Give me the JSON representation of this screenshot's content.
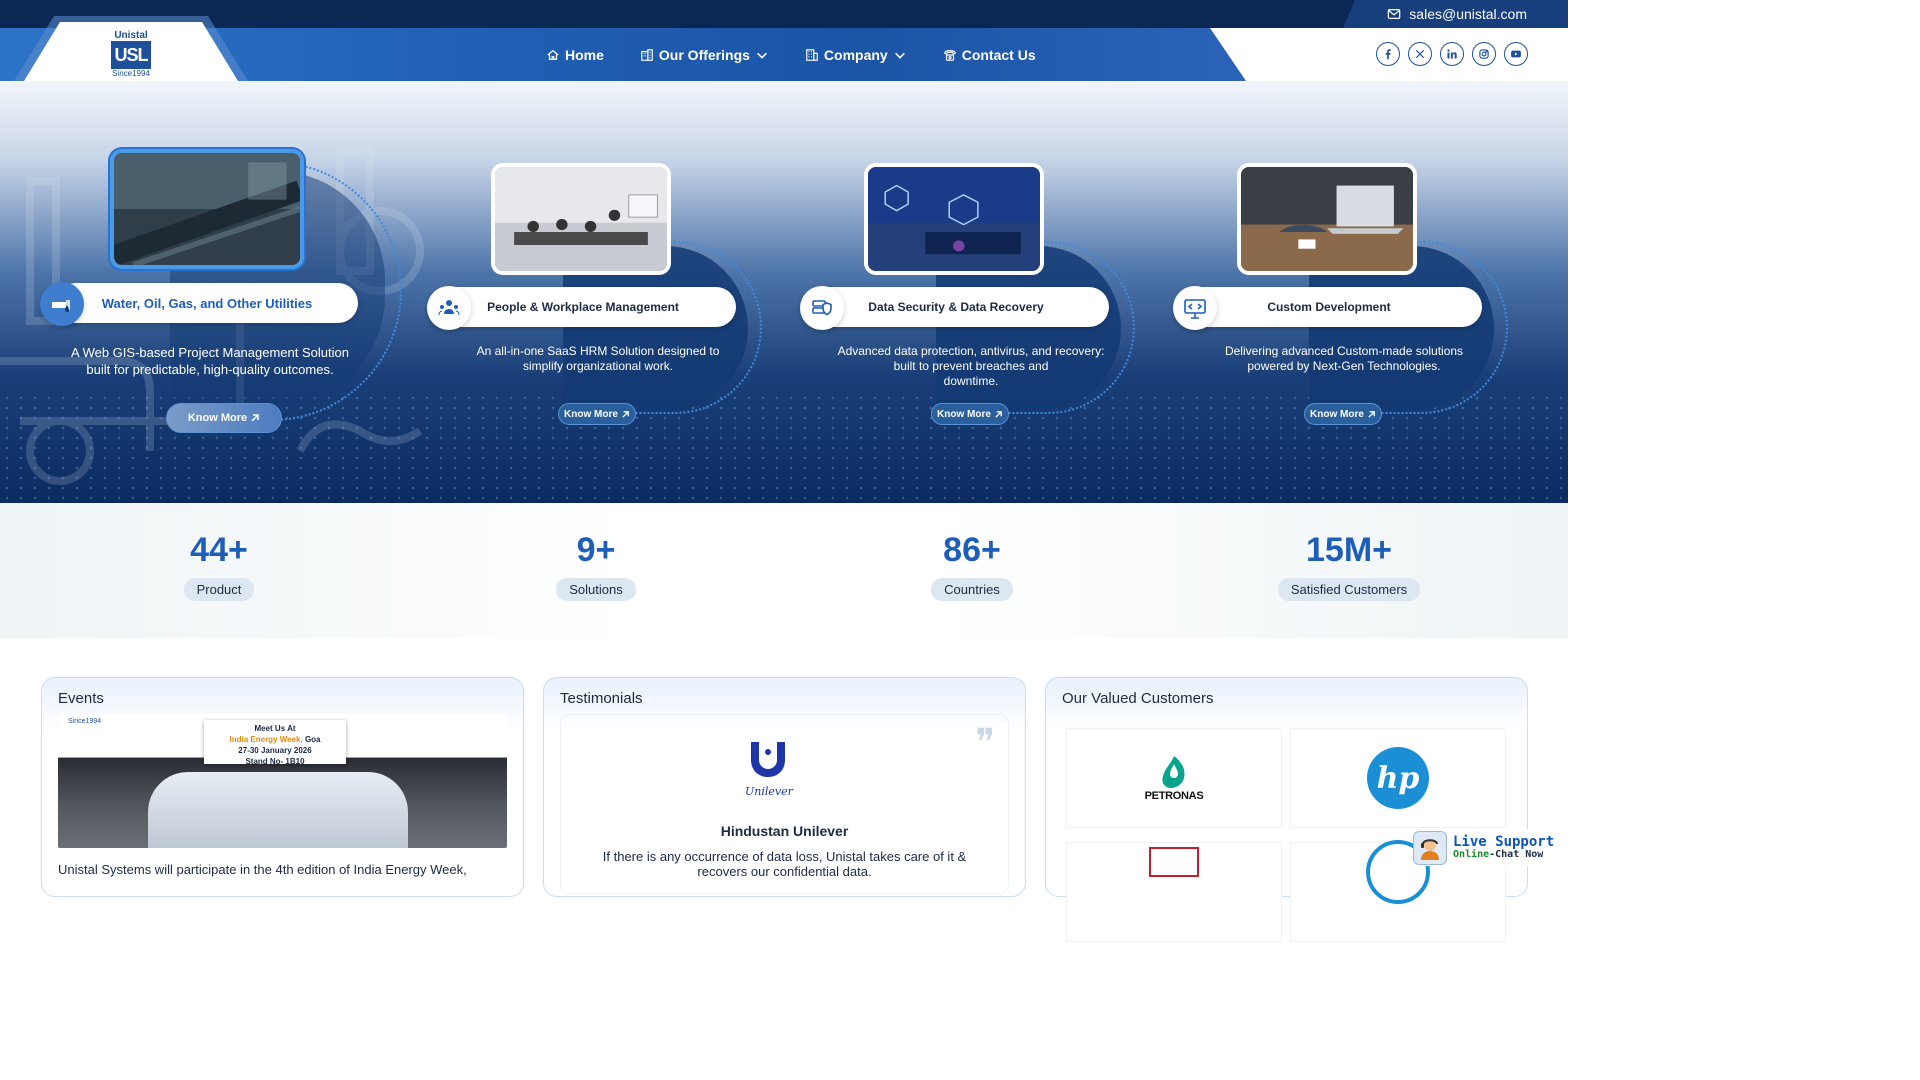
{
  "topbar": {
    "email": "sales@unistal.com"
  },
  "logo": {
    "top": "Unistal",
    "mark": "USL",
    "since": "Since1994"
  },
  "nav": [
    {
      "label": "Home",
      "icon": "home-icon"
    },
    {
      "label": "Our Offerings",
      "icon": "building-icon"
    },
    {
      "label": "Company",
      "icon": "office-icon"
    },
    {
      "label": "Contact Us",
      "icon": "phone-icon"
    }
  ],
  "social": [
    "facebook-icon",
    "x-icon",
    "linkedin-icon",
    "instagram-icon",
    "youtube-icon"
  ],
  "hero": {
    "cards": [
      {
        "title": "Water, Oil, Gas, and Other Utilities",
        "desc_line1": "A Web GIS-based Project Management Solution",
        "desc_line2": "built for predictable, high-quality outcomes.",
        "desc_line3": "",
        "button": "Know More"
      },
      {
        "title": "People & Workplace Management",
        "desc_line1": "An all-in-one SaaS HRM Solution designed to",
        "desc_line2": "simplify organizational work.",
        "desc_line3": "",
        "button": "Know More"
      },
      {
        "title": "Data Security & Data Recovery",
        "desc_line1": "Advanced data protection, antivirus, and recovery:",
        "desc_line2": "built to prevent breaches and",
        "desc_line3": "downtime.",
        "button": "Know More"
      },
      {
        "title": "Custom Development",
        "desc_line1": "Delivering advanced Custom-made solutions",
        "desc_line2": "powered by Next-Gen Technologies.",
        "desc_line3": "",
        "button": "Know More"
      }
    ]
  },
  "stats": [
    {
      "value": "44+",
      "label": "Product"
    },
    {
      "value": "9+",
      "label": "Solutions"
    },
    {
      "value": "86+",
      "label": "Countries"
    },
    {
      "value": "15M+",
      "label": "Satisfied Customers"
    }
  ],
  "events": {
    "title": "Events",
    "since": "Since1994",
    "banner_line1": "Meet Us At",
    "banner_line2_orange": "India Energy Week,",
    "banner_line2_rest": " Goa",
    "banner_line3": "27-30 January 2026",
    "banner_line4": "Stand No- 1B10",
    "text": "Unistal Systems will participate in the 4th edition of India Energy Week,"
  },
  "testimonials": {
    "title": "Testimonials",
    "logo_text": "Unilever",
    "name": "Hindustan Unilever",
    "quote_line1": "If there is any occurrence of data loss, Unistal takes care of it &",
    "quote_line2": "recovers our confidential data."
  },
  "customers": {
    "title": "Our Valued Customers",
    "logos": [
      "PETRONAS",
      "hp"
    ]
  },
  "live_support": {
    "title": "Live Support",
    "sub_green": "Online",
    "sub_dark": "-Chat Now"
  }
}
